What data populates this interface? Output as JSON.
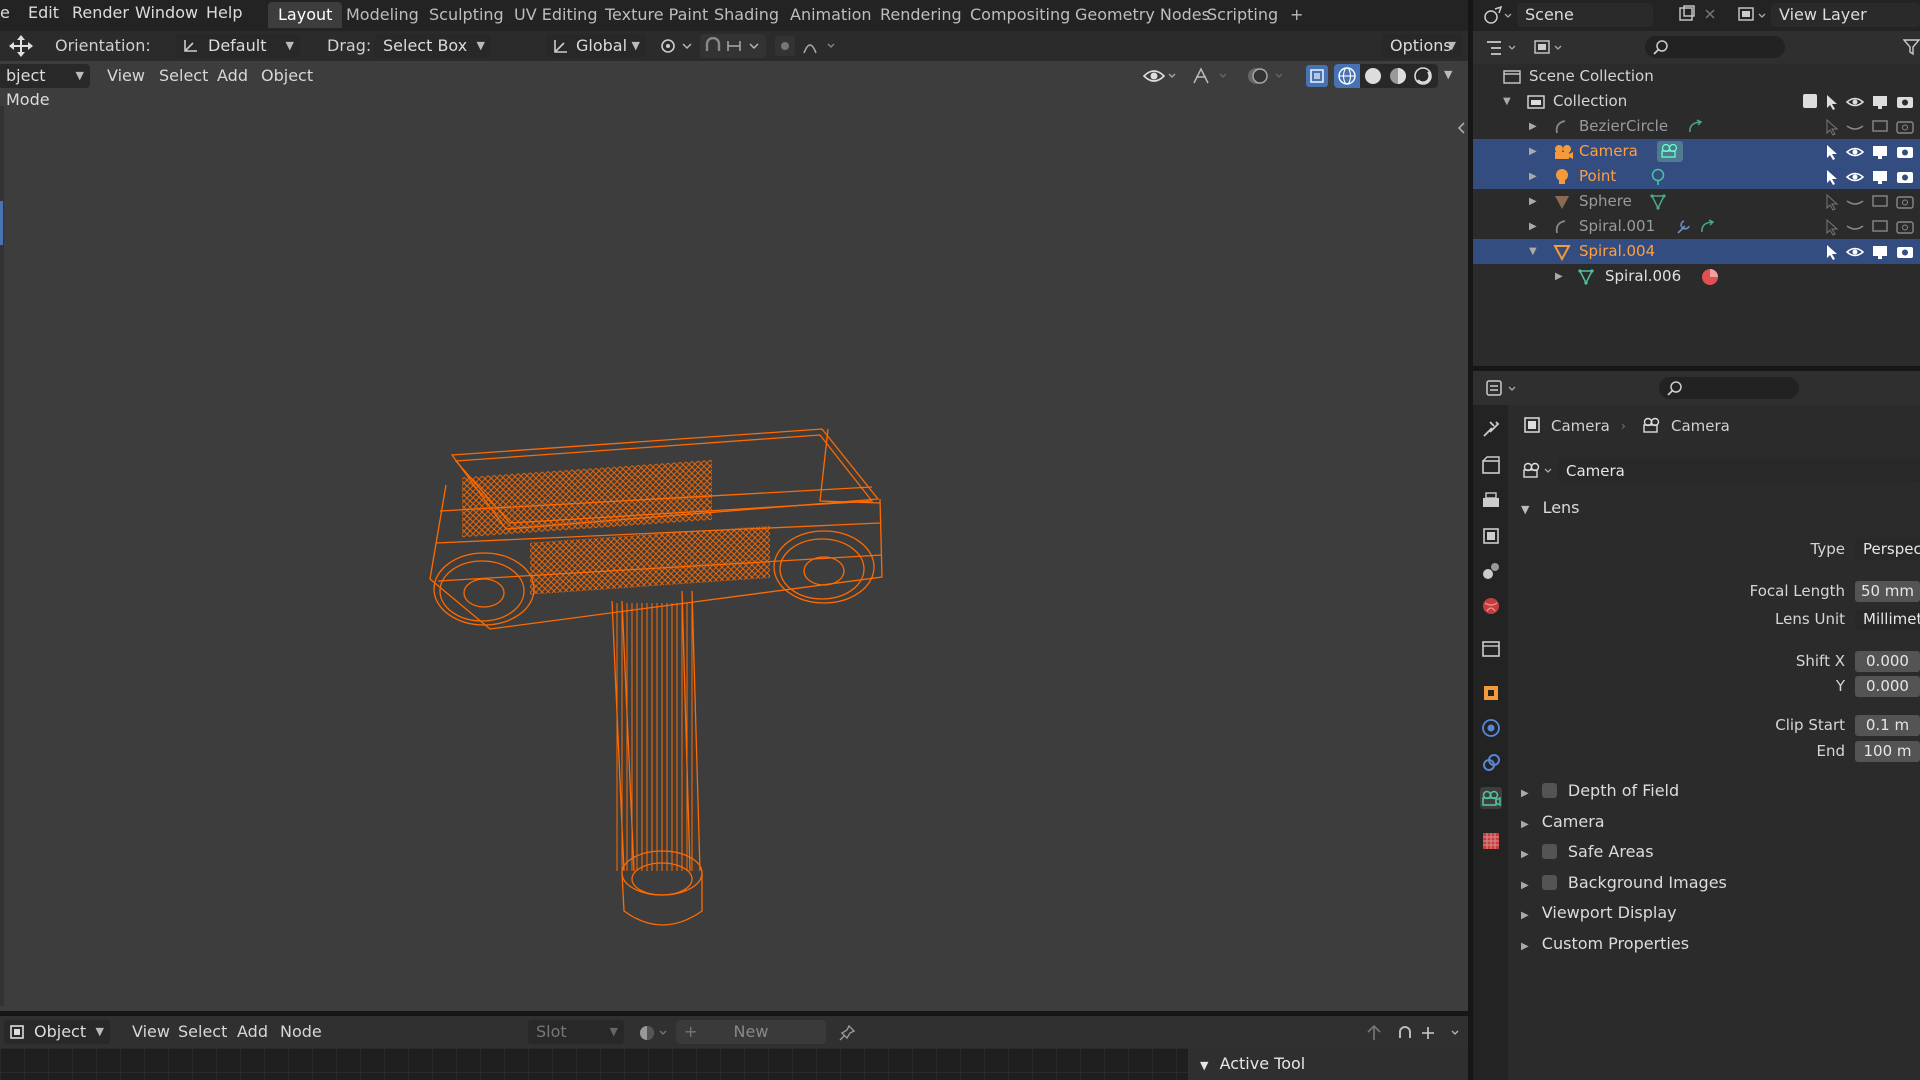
{
  "topbar": {
    "menus": [
      "e",
      "Edit",
      "Render",
      "Window",
      "Help"
    ],
    "workspaces": [
      "Layout",
      "Modeling",
      "Sculpting",
      "UV Editing",
      "Texture Paint",
      "Shading",
      "Animation",
      "Rendering",
      "Compositing",
      "Geometry Nodes",
      "Scripting"
    ],
    "active_workspace": "Layout",
    "add_tab": "+",
    "scene": "Scene",
    "view_layer": "View Layer"
  },
  "viewport": {
    "orientation_label": "Orientation:",
    "orientation_value": "Default",
    "drag_label": "Drag:",
    "drag_value": "Select Box",
    "transform_value": "Global",
    "options_label": "Options",
    "mode": "bject Mode",
    "menu": [
      "View",
      "Select",
      "Add",
      "Object"
    ],
    "wire_color": "#ff6a00"
  },
  "node_editor": {
    "type": "Object",
    "menu": [
      "View",
      "Select",
      "Add",
      "Node"
    ],
    "slot_label": "Slot",
    "new_label": "New",
    "active_tool": "Active Tool"
  },
  "outliner": {
    "scene_collection": "Scene Collection",
    "collection": "Collection",
    "items": [
      {
        "name": "BezierCircle",
        "color": "#9a9a9a",
        "selected": false
      },
      {
        "name": "Camera",
        "color": "#ff9f40",
        "selected": true
      },
      {
        "name": "Point",
        "color": "#ff9f40",
        "selected": true
      },
      {
        "name": "Sphere",
        "color": "#9a9a9a",
        "selected": false
      },
      {
        "name": "Spiral.001",
        "color": "#9a9a9a",
        "selected": false
      },
      {
        "name": "Spiral.004",
        "color": "#ff9f40",
        "selected": true
      }
    ],
    "child": "Spiral.006"
  },
  "properties": {
    "breadcrumb_object": "Camera",
    "breadcrumb_data": "Camera",
    "data_name": "Camera",
    "lens_panel": "Lens",
    "type_label": "Type",
    "type_value": "Perspective",
    "focal_length_label": "Focal Length",
    "focal_length_value": "50 mm",
    "lens_unit_label": "Lens Unit",
    "lens_unit_value": "Millimeters",
    "shift_x_label": "Shift X",
    "shift_x_value": "0.000",
    "shift_y_label": "Y",
    "shift_y_value": "0.000",
    "clip_start_label": "Clip Start",
    "clip_start_value": "0.1 m",
    "clip_end_label": "End",
    "clip_end_value": "100 m",
    "panels": [
      "Depth of Field",
      "Camera",
      "Safe Areas",
      "Background Images",
      "Viewport Display",
      "Custom Properties"
    ]
  }
}
